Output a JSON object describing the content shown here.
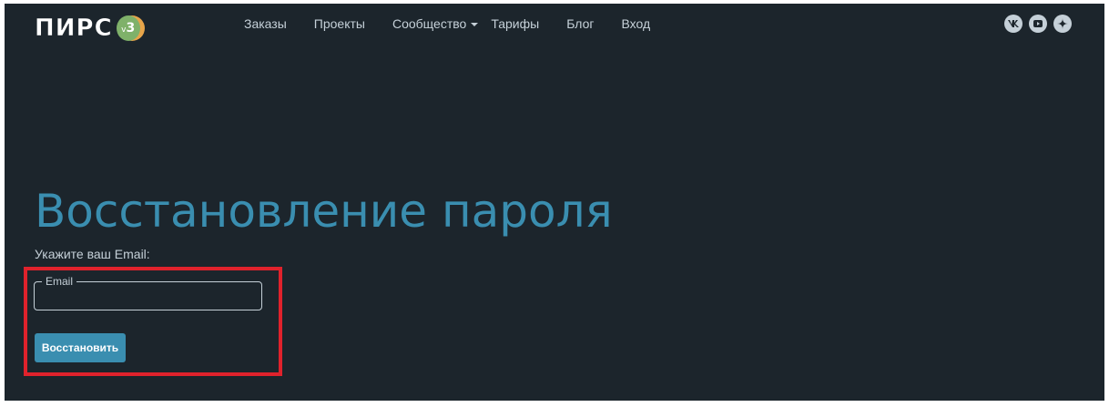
{
  "header": {
    "logo_text": "ПИРС",
    "logo_badge_prefix": "v",
    "logo_badge_version": "3",
    "nav": [
      {
        "label": "Заказы"
      },
      {
        "label": "Проекты"
      },
      {
        "label": "Сообщество"
      },
      {
        "label": "Тарифы"
      },
      {
        "label": "Блог"
      },
      {
        "label": "Вход"
      }
    ],
    "social_icons": [
      "vk-icon",
      "youtube-icon",
      "zen-icon"
    ]
  },
  "main": {
    "title": "Восстановление пароля",
    "hint": "Укажите ваш Email:",
    "email_label": "Email",
    "email_value": "",
    "restore_label": "Восстановить"
  },
  "colors": {
    "background": "#1c252c",
    "accent": "#3a8eb0",
    "highlight": "#e0222c",
    "text": "#c5d0d8"
  }
}
